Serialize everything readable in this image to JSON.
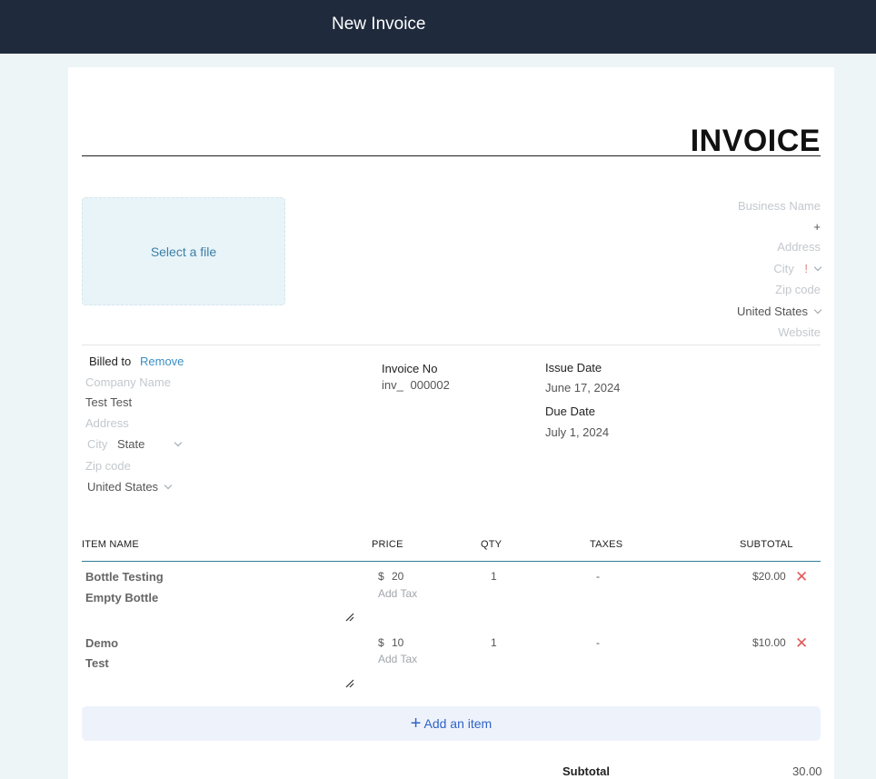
{
  "app": {
    "title": "New Invoice"
  },
  "invoice": {
    "heading": "INVOICE"
  },
  "logo": {
    "select_label": "Select a file"
  },
  "business": {
    "name_placeholder": "Business Name",
    "plus": "+",
    "address_placeholder": "Address",
    "city_placeholder": "City",
    "state_value": "!",
    "zip_placeholder": "Zip code",
    "country": "United States",
    "website_placeholder": "Website"
  },
  "billed": {
    "label": "Billed to",
    "remove": "Remove",
    "company_placeholder": "Company Name",
    "name": "Test Test",
    "address_placeholder": "Address",
    "city_placeholder": "City",
    "state": "State",
    "zip_placeholder": "Zip code",
    "country": "United States"
  },
  "meta": {
    "invoice_no_label": "Invoice No",
    "invoice_prefix": "inv_",
    "invoice_number": "000002",
    "issue_label": "Issue Date",
    "issue_date": "June 17, 2024",
    "due_label": "Due Date",
    "due_date": "July 1, 2024"
  },
  "table": {
    "headers": {
      "item": "ITEM NAME",
      "price": "PRICE",
      "qty": "QTY",
      "taxes": "TAXES",
      "subtotal": "SUBTOTAL"
    },
    "currency": "$",
    "add_tax": "Add Tax",
    "rows": [
      {
        "name": "Bottle Testing",
        "description": "Empty Bottle",
        "price": "20",
        "qty": "1",
        "taxes": "-",
        "subtotal": "$20.00"
      },
      {
        "name": "Demo",
        "description": "Test",
        "price": "10",
        "qty": "1",
        "taxes": "-",
        "subtotal": "$10.00"
      }
    ],
    "add_item": "Add an item"
  },
  "totals": {
    "subtotal_label": "Subtotal",
    "subtotal_value": "30.00"
  },
  "colors": {
    "header_bg": "#1f2a3c",
    "accent": "#3b8fc4",
    "delete": "#e05a5a",
    "table_rule": "#2f7d96"
  }
}
